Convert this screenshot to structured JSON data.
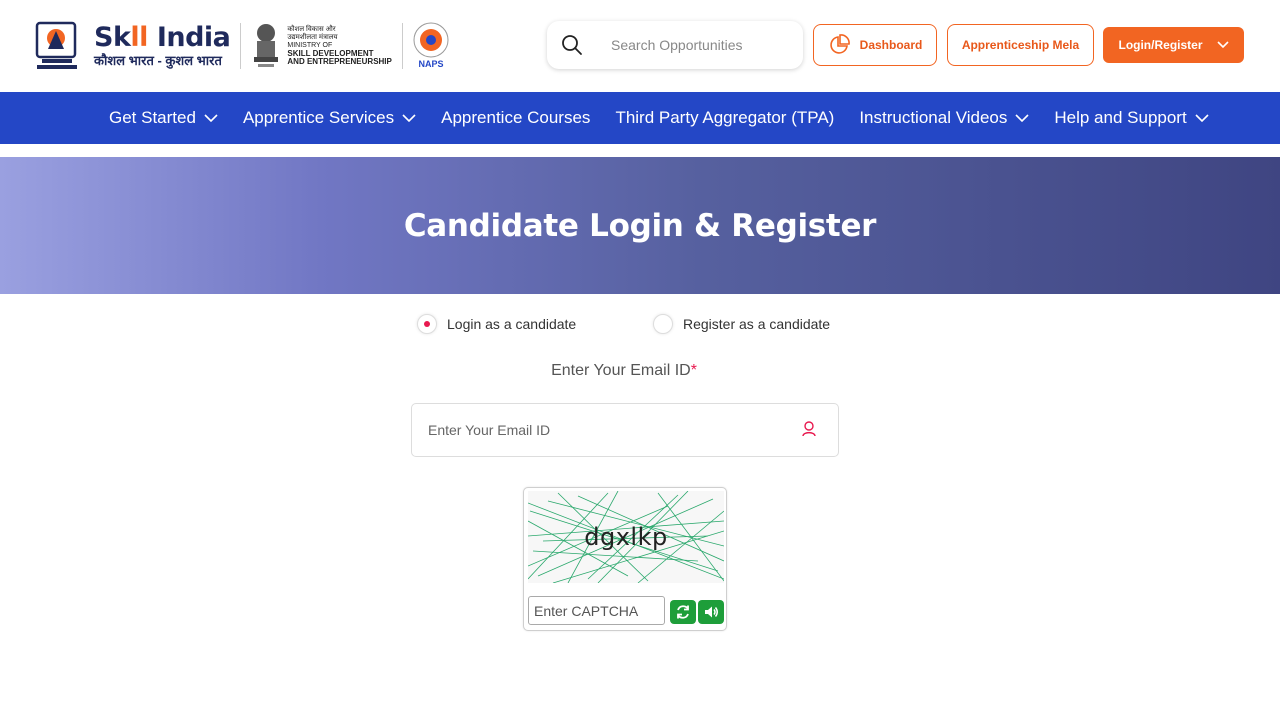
{
  "header": {
    "brand_title_pre": "Sk",
    "brand_title_ll": "ll",
    "brand_title_post": " India",
    "brand_subtitle": "कौशल भारत - कुशल भारत",
    "ministry_line1": "कौशल विकास और",
    "ministry_line2": "उद्यमशीलता मंत्रालय",
    "ministry_line3": "MINISTRY OF",
    "ministry_line4": "SKILL DEVELOPMENT",
    "ministry_line5": "AND ENTREPRENEURSHIP",
    "naps_label": "NAPS",
    "search_placeholder": "Search Opportunities",
    "dashboard_label": "Dashboard",
    "mela_label": "Apprenticeship Mela",
    "login_label": "Login/Register"
  },
  "nav": {
    "items": [
      {
        "label": "Get Started",
        "dropdown": true
      },
      {
        "label": "Apprentice Services",
        "dropdown": true
      },
      {
        "label": "Apprentice Courses",
        "dropdown": false
      },
      {
        "label": "Third Party Aggregator (TPA)",
        "dropdown": false
      },
      {
        "label": "Instructional Videos",
        "dropdown": true
      },
      {
        "label": "Help and Support",
        "dropdown": true
      }
    ]
  },
  "banner": {
    "title": "Candidate Login & Register"
  },
  "form": {
    "radio_login": "Login as a candidate",
    "radio_register": "Register as a candidate",
    "selected": "login",
    "email_label": "Enter Your Email ID",
    "required_mark": "*",
    "email_placeholder": "Enter Your Email ID",
    "captcha_text": "dgxlkp",
    "captcha_placeholder": "Enter CAPTCHA"
  },
  "colors": {
    "primary_nav": "#2447c6",
    "accent_orange": "#f26522",
    "radio_active": "#e8194f",
    "captcha_button": "#1e9e3a"
  }
}
